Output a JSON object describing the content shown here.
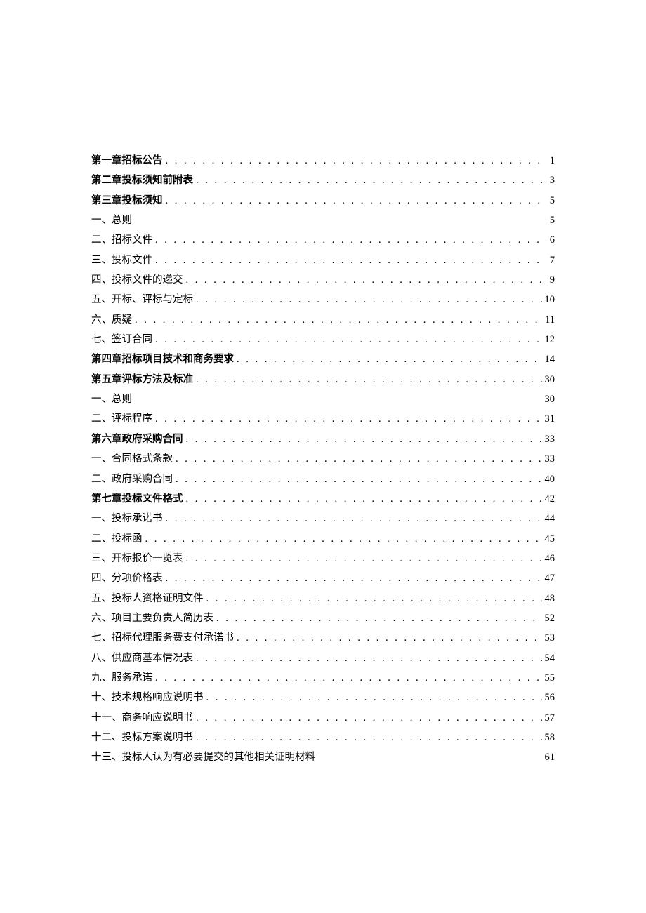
{
  "toc": [
    {
      "title": "第一章招标公告",
      "page": "1",
      "bold": true,
      "leader": true
    },
    {
      "title": "第二章投标须知前附表",
      "page": "3",
      "bold": true,
      "leader": true
    },
    {
      "title": "第三章投标须知",
      "page": "5",
      "bold": true,
      "leader": true
    },
    {
      "title": "一、总则",
      "page": "5",
      "bold": false,
      "leader": false
    },
    {
      "title": "二、招标文件",
      "page": "6",
      "bold": false,
      "leader": true
    },
    {
      "title": "三、投标文件",
      "page": "7",
      "bold": false,
      "leader": true
    },
    {
      "title": "四、投标文件的递交",
      "page": "9",
      "bold": false,
      "leader": true
    },
    {
      "title": "五、开标、评标与定标",
      "page": "10",
      "bold": false,
      "leader": true
    },
    {
      "title": "六、质疑",
      "page": "11",
      "bold": false,
      "leader": true
    },
    {
      "title": "七、签订合同",
      "page": "12",
      "bold": false,
      "leader": true
    },
    {
      "title": "第四章招标项目技术和商务要求",
      "page": "14",
      "bold": true,
      "leader": true
    },
    {
      "title": "第五章评标方法及标准",
      "page": "30",
      "bold": true,
      "leader": true
    },
    {
      "title": "一、总则",
      "page": "30",
      "bold": false,
      "leader": false
    },
    {
      "title": "二、评标程序",
      "page": "31",
      "bold": false,
      "leader": true
    },
    {
      "title": "第六章政府采购合同",
      "page": "33",
      "bold": true,
      "leader": true
    },
    {
      "title": "一、合同格式条款",
      "page": "33",
      "bold": false,
      "leader": true
    },
    {
      "title": "二、政府采购合同",
      "page": "40",
      "bold": false,
      "leader": true
    },
    {
      "title": "第七章投标文件格式",
      "page": "42",
      "bold": true,
      "leader": true
    },
    {
      "title": "一、投标承诺书",
      "page": "44",
      "bold": false,
      "leader": true
    },
    {
      "title": "二、投标函",
      "page": "45",
      "bold": false,
      "leader": true
    },
    {
      "title": "三、开标报价一览表",
      "page": "46",
      "bold": false,
      "leader": true
    },
    {
      "title": "四、分项价格表",
      "page": "47",
      "bold": false,
      "leader": true
    },
    {
      "title": "五、投标人资格证明文件",
      "page": "48",
      "bold": false,
      "leader": true
    },
    {
      "title": "六、项目主要负责人简历表",
      "page": "52",
      "bold": false,
      "leader": true
    },
    {
      "title": "七、招标代理服务费支付承诺书",
      "page": "53",
      "bold": false,
      "leader": true
    },
    {
      "title": "八、供应商基本情况表",
      "page": "54",
      "bold": false,
      "leader": true
    },
    {
      "title": "九、服务承诺",
      "page": "55",
      "bold": false,
      "leader": true
    },
    {
      "title": "十、技术规格响应说明书",
      "page": "56",
      "bold": false,
      "leader": true
    },
    {
      "title": "十一、商务响应说明书",
      "page": "57",
      "bold": false,
      "leader": true
    },
    {
      "title": "十二、投标方案说明书",
      "page": "58",
      "bold": false,
      "leader": true
    },
    {
      "title": "十三、投标人认为有必要提交的其他相关证明材料",
      "page": "61",
      "bold": false,
      "leader": false
    }
  ]
}
